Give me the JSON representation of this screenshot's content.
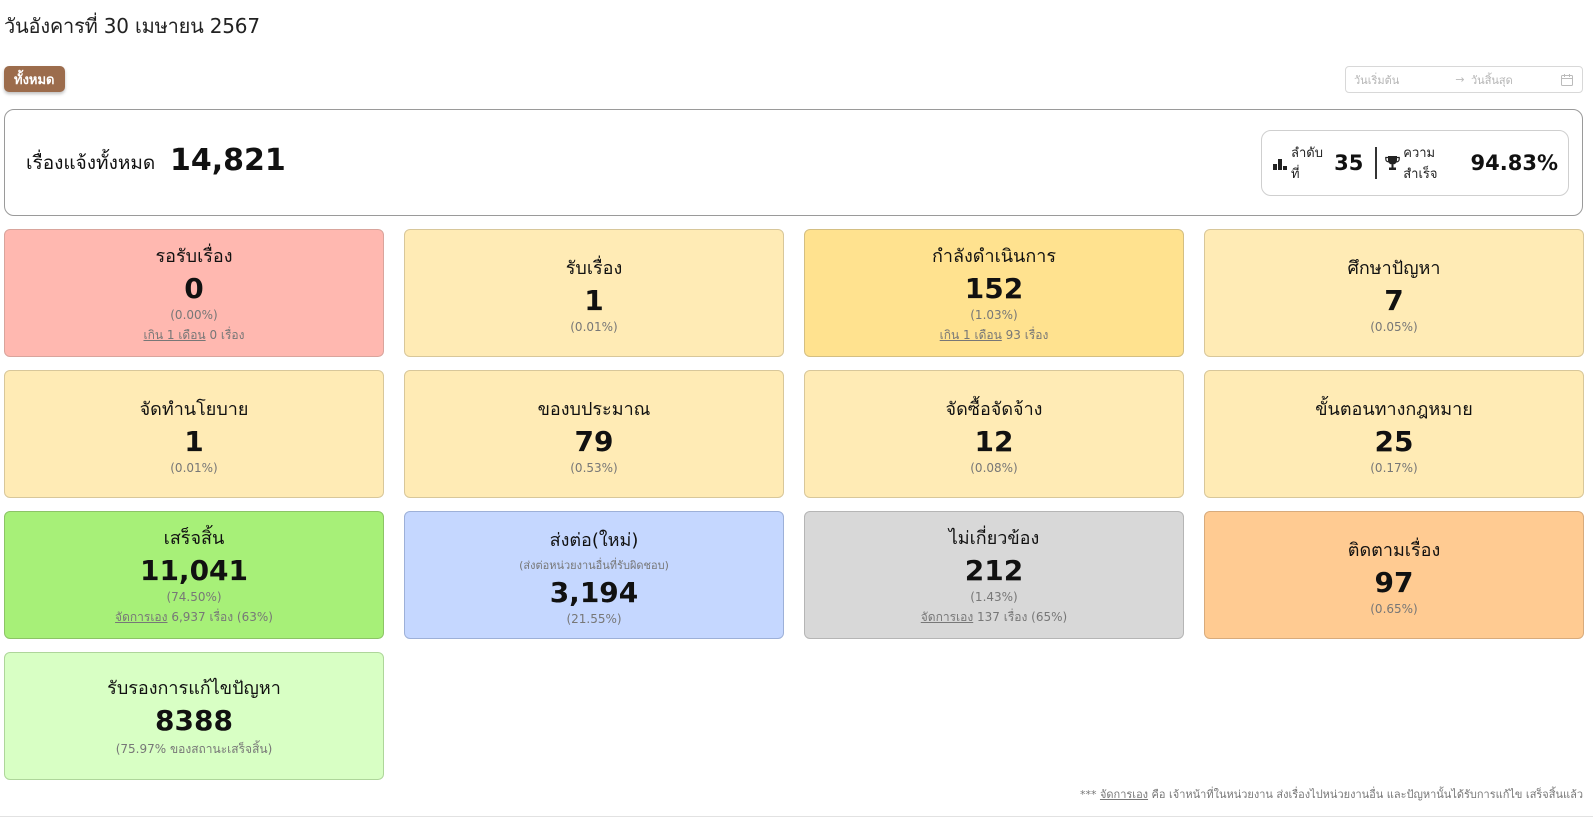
{
  "header": {
    "date_title": "วันอังคารที่ 30 เมษายน 2567",
    "filter_label": "ทั้งหมด",
    "date_start_placeholder": "วันเริ่มต้น",
    "date_end_placeholder": "วันสิ้นสุด",
    "date_separator": "→"
  },
  "summary": {
    "label": "เรื่องแจ้งทั้งหมด",
    "total": "14,821",
    "rank_label": "ลำดับที่",
    "rank_value": "35",
    "success_label": "ความสำเร็จ",
    "success_value": "94.83%"
  },
  "cards": [
    {
      "title": "รอรับเรื่อง",
      "value": "0",
      "pct": "(0.00%)",
      "note_link": "เกิน 1 เดือน",
      "note_rest": " 0 เรื่อง"
    },
    {
      "title": "รับเรื่อง",
      "value": "1",
      "pct": "(0.01%)"
    },
    {
      "title": "กำลังดำเนินการ",
      "value": "152",
      "pct": "(1.03%)",
      "note_link": "เกิน 1 เดือน",
      "note_rest": " 93 เรื่อง"
    },
    {
      "title": "ศึกษาปัญหา",
      "value": "7",
      "pct": "(0.05%)"
    },
    {
      "title": "จัดทำนโยบาย",
      "value": "1",
      "pct": "(0.01%)"
    },
    {
      "title": "ของบประมาณ",
      "value": "79",
      "pct": "(0.53%)"
    },
    {
      "title": "จัดซื้อจัดจ้าง",
      "value": "12",
      "pct": "(0.08%)"
    },
    {
      "title": "ขั้นตอนทางกฎหมาย",
      "value": "25",
      "pct": "(0.17%)"
    },
    {
      "title": "เสร็จสิ้น",
      "value": "11,041",
      "pct": "(74.50%)",
      "note_link": "จัดการเอง",
      "note_rest": " 6,937 เรื่อง (63%)"
    },
    {
      "title": "ส่งต่อ(ใหม่)",
      "subtitle": "(ส่งต่อหน่วยงานอื่นที่รับผิดชอบ)",
      "value": "3,194",
      "pct": "(21.55%)"
    },
    {
      "title": "ไม่เกี่ยวข้อง",
      "value": "212",
      "pct": "(1.43%)",
      "note_link": "จัดการเอง",
      "note_rest": " 137 เรื่อง (65%)"
    },
    {
      "title": "ติดตามเรื่อง",
      "value": "97",
      "pct": "(0.65%)"
    },
    {
      "title": "รับรองการแก้ไขปัญหา",
      "value": "8388",
      "pct": "(75.97% ของสถานะเสร็จสิ้น)"
    }
  ],
  "footnote": {
    "prefix": "*** ",
    "link": "จัดการเอง",
    "text": " คือ เจ้าหน้าที่ในหน่วยงาน ส่งเรื่องไปหน่วยงานอื่น และปัญหานั้นได้รับการแก้ไข เสร็จสิ้นแล้ว"
  },
  "colors": {
    "filter_button": "#9c6c4c",
    "pending": "#ffb8b0",
    "neutral": "#ffebb5",
    "in_progress": "#ffe28f",
    "done": "#a7f078",
    "forwarded": "#c5d7ff",
    "irrelevant": "#d8d8d8",
    "follow_up": "#ffcb92",
    "certified": "#d8ffc4"
  },
  "icons": {
    "rank": "podium-icon",
    "success": "trophy-icon",
    "date": "calendar-icon"
  }
}
